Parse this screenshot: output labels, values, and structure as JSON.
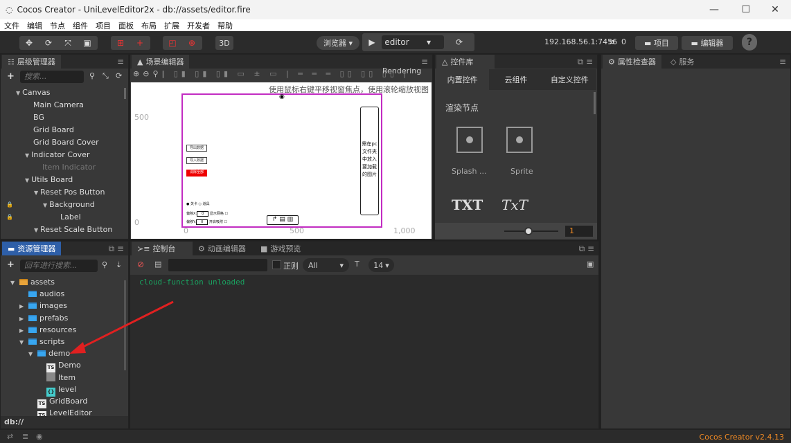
{
  "window": {
    "title": "Cocos Creator - UniLevelEditor2x - db://assets/editor.fire",
    "controls": [
      "—",
      "☐",
      "✕"
    ]
  },
  "menu": [
    "文件",
    "编辑",
    "节点",
    "组件",
    "项目",
    "面板",
    "布局",
    "扩展",
    "开发者",
    "帮助"
  ],
  "toolbar": {
    "three_d": "3D",
    "browser": "浏览器 ▾",
    "preview_target": "editor",
    "ip": "192.168.56.1:7456",
    "connections": "0",
    "project_btn": "项目",
    "editor_btn": "编辑器",
    "help": "?"
  },
  "hierarchy": {
    "title": "层级管理器",
    "search_placeholder": "搜索...",
    "items": [
      {
        "label": "Canvas",
        "depth": 0,
        "fold": "open"
      },
      {
        "label": "Main Camera",
        "depth": 1
      },
      {
        "label": "BG",
        "depth": 1
      },
      {
        "label": "Grid Board",
        "depth": 1
      },
      {
        "label": "Grid Board Cover",
        "depth": 1
      },
      {
        "label": "Indicator Cover",
        "depth": 1,
        "fold": "open"
      },
      {
        "label": "Item Indicator",
        "depth": 2,
        "dim": true
      },
      {
        "label": "Utils Board",
        "depth": 1,
        "fold": "open"
      },
      {
        "label": "Reset Pos Button",
        "depth": 2,
        "fold": "open"
      },
      {
        "label": "Background",
        "depth": 3,
        "fold": "open",
        "locked": true
      },
      {
        "label": "Label",
        "depth": 4,
        "locked": true
      },
      {
        "label": "Reset Scale Button",
        "depth": 2,
        "fold": "open"
      }
    ]
  },
  "scene": {
    "title": "场景编辑器",
    "rendering": "Rendering",
    "hint": "使用鼠标右键平移视窗焦点，使用滚轮缩放视图",
    "y_ticks": [
      "500",
      "0"
    ],
    "x_ticks": [
      "0",
      "500",
      "1,000"
    ],
    "canvas": {
      "buttons": [
        "导出数据",
        "导入数据",
        "清除全部"
      ],
      "side_text": "需在pc文件夹中放入要加载的图片",
      "radios": [
        "关卡",
        "道具"
      ],
      "fields": [
        "偏移X:",
        "偏移Y:",
        "显示网格",
        "开启吸附"
      ],
      "values": [
        "0",
        "0"
      ]
    }
  },
  "library": {
    "title": "控件库",
    "tabs": [
      "内置控件",
      "云组件",
      "自定义控件"
    ],
    "section": "渲染节点",
    "items": [
      "Splash ...",
      "Sprite"
    ],
    "text_items": [
      "TXT",
      "TxT"
    ],
    "zoom_value": "1",
    "zoom_level": 0.45
  },
  "inspector": {
    "tabs": [
      "属性检查器",
      "服务"
    ]
  },
  "assets": {
    "title": "资源管理器",
    "search_placeholder": "回车进行搜索...",
    "path": "db://",
    "items": [
      {
        "label": "assets",
        "depth": 0,
        "fold": "open",
        "type": "root"
      },
      {
        "label": "audios",
        "depth": 1,
        "type": "folder"
      },
      {
        "label": "images",
        "depth": 1,
        "fold": "closed",
        "type": "folder"
      },
      {
        "label": "prefabs",
        "depth": 1,
        "fold": "closed",
        "type": "folder"
      },
      {
        "label": "resources",
        "depth": 1,
        "fold": "closed",
        "type": "folder"
      },
      {
        "label": "scripts",
        "depth": 1,
        "fold": "open",
        "type": "folder"
      },
      {
        "label": "demo",
        "depth": 2,
        "fold": "open",
        "type": "folder"
      },
      {
        "label": "Demo",
        "depth": 3,
        "type": "ts"
      },
      {
        "label": "Item",
        "depth": 3,
        "type": "prefab"
      },
      {
        "label": "level",
        "depth": 3,
        "type": "json"
      },
      {
        "label": "GridBoard",
        "depth": 2,
        "type": "ts"
      },
      {
        "label": "LevelEditor",
        "depth": 2,
        "type": "ts"
      }
    ]
  },
  "console": {
    "tabs": [
      "控制台",
      "动画编辑器",
      "游戏预览"
    ],
    "regex": "正则",
    "level": "All",
    "font_size": "14",
    "lines": [
      "cloud-function unloaded"
    ]
  },
  "status": {
    "version": "Cocos Creator v2.4.13"
  },
  "colors": {
    "accent": "#2e5fa8",
    "console_text": "#1aa260",
    "annotation_arrow": "#e02020",
    "version": "#f08a24"
  }
}
